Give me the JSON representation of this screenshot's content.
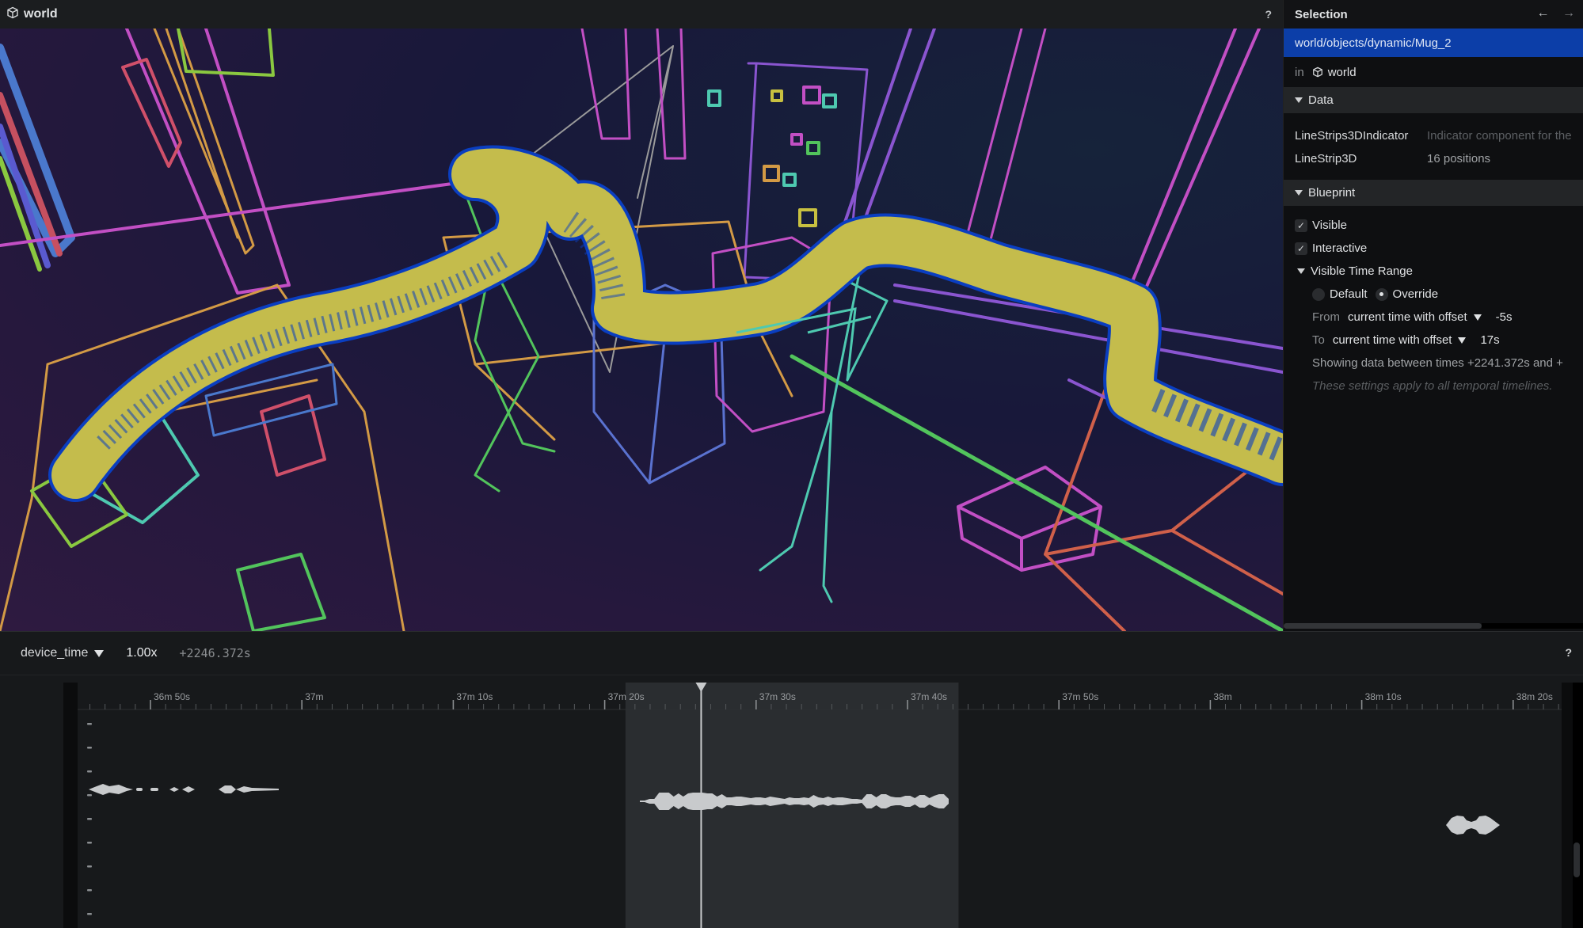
{
  "viewport": {
    "title": "world",
    "icon": "cube-icon",
    "help_label": "?"
  },
  "selection": {
    "title": "Selection",
    "nav_back": "←",
    "nav_forward": "→",
    "path": "world/objects/dynamic/Mug_2",
    "in_label": "in",
    "in_space": "world",
    "data_section": {
      "label": "Data",
      "rows": [
        {
          "key": "LineStrips3DIndicator",
          "value": "Indicator component for the"
        },
        {
          "key": "LineStrip3D",
          "value": "16 positions"
        }
      ]
    },
    "blueprint_section": {
      "label": "Blueprint",
      "visible_label": "Visible",
      "visible_checked": true,
      "interactive_label": "Interactive",
      "interactive_checked": true,
      "time_range_label": "Visible Time Range",
      "default_label": "Default",
      "override_label": "Override",
      "selected_mode": "Override",
      "from_label": "From",
      "from_mode": "current time with offset",
      "from_value": "-5s",
      "to_label": "To",
      "to_mode": "current time with offset",
      "to_value": "17s",
      "showing_text": "Showing data between times +2241.372s and +",
      "note_text": "These settings apply to all temporal timelines."
    }
  },
  "timeline": {
    "timeline_name": "device_time",
    "speed": "1.00x",
    "current_time": "+2246.372s",
    "help_label": "?",
    "tick_labels": [
      "36m 50s",
      "37m",
      "37m 10s",
      "37m 20s",
      "37m 30s",
      "37m 40s",
      "37m 50s",
      "38m",
      "38m 10s",
      "38m 20s"
    ],
    "visible_range": {
      "from": "+2241.372s",
      "to_offset_s": 17
    }
  },
  "colors": {
    "selection_highlight": "#0c3ea8",
    "mug_fill": "#c4bc4c",
    "mug_outline": "#0a3ec0",
    "magenta": "#c24fc4",
    "green": "#52c45c",
    "orange": "#d39a45",
    "teal": "#4ec9b0",
    "blue": "#5a72d0",
    "red": "#d0604a",
    "purple": "#8a55d0"
  }
}
